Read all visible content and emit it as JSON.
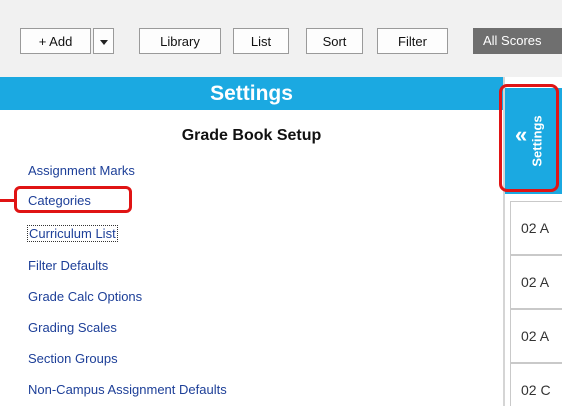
{
  "toolbar": {
    "add_label": "+ Add",
    "library_label": "Library",
    "list_label": "List",
    "sort_label": "Sort",
    "filter_label": "Filter",
    "all_scores_label": "All Scores"
  },
  "settings_panel": {
    "header": "Settings",
    "section_title": "Grade Book Setup",
    "links": [
      "Assignment Marks",
      "Categories",
      "Curriculum List",
      "Filter Defaults",
      "Grade Calc Options",
      "Grading Scales",
      "Section Groups",
      "Non-Campus Assignment Defaults"
    ]
  },
  "side_tab": {
    "label": "Settings",
    "icon": "double-chevron-left-icon"
  },
  "right_rows": [
    "02 A",
    "02 A",
    "02 A",
    "02 C"
  ],
  "colors": {
    "accent": "#1ba9e1",
    "link": "#1d3f98",
    "highlight": "#e01414",
    "toolbar_bg": "#f1f1f1"
  }
}
